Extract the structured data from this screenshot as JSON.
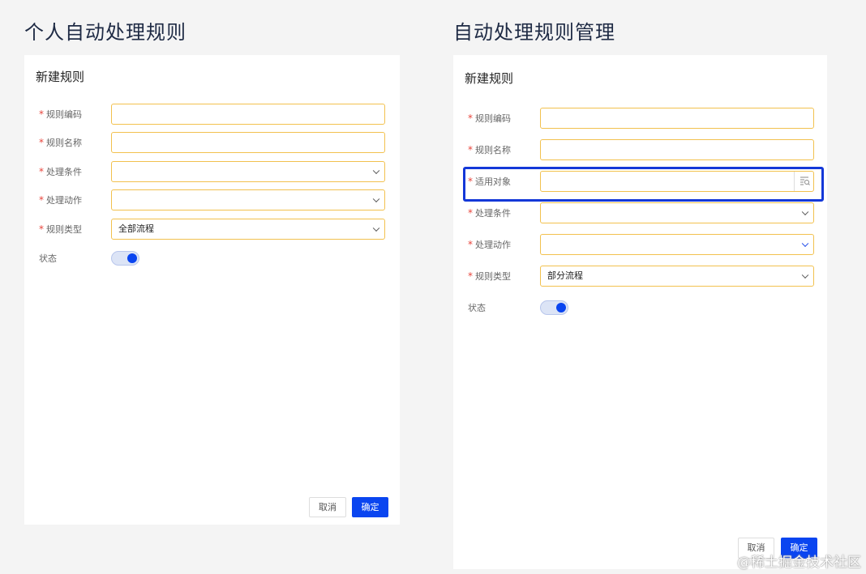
{
  "left": {
    "section_title": "个人自动处理规则",
    "panel_title": "新建规则",
    "required_mark": "*",
    "fields": [
      {
        "label": "规则编码",
        "value": "",
        "type": "text"
      },
      {
        "label": "规则名称",
        "value": "",
        "type": "text"
      },
      {
        "label": "处理条件",
        "value": "",
        "type": "select"
      },
      {
        "label": "处理动作",
        "value": "",
        "type": "select"
      },
      {
        "label": "规则类型",
        "value": "全部流程",
        "type": "select"
      }
    ],
    "status_label": "状态",
    "status_on": true,
    "cancel_label": "取消",
    "ok_label": "确定"
  },
  "right": {
    "section_title": "自动处理规则管理",
    "panel_title": "新建规则",
    "required_mark": "*",
    "fields": [
      {
        "label": "规则编码",
        "value": "",
        "type": "text"
      },
      {
        "label": "规则名称",
        "value": "",
        "type": "text"
      },
      {
        "label": "适用对象",
        "value": "",
        "type": "lookup"
      },
      {
        "label": "处理条件",
        "value": "",
        "type": "select"
      },
      {
        "label": "处理动作",
        "value": "",
        "type": "select"
      },
      {
        "label": "规则类型",
        "value": "部分流程",
        "type": "select"
      }
    ],
    "status_label": "状态",
    "status_on": true,
    "cancel_label": "取消",
    "ok_label": "确定"
  },
  "watermark": "@稀土掘金技术社区",
  "colors": {
    "primary": "#0a45f0",
    "required": "#e8453c",
    "field_border": "#f2c14e",
    "highlight": "#1438d8"
  }
}
